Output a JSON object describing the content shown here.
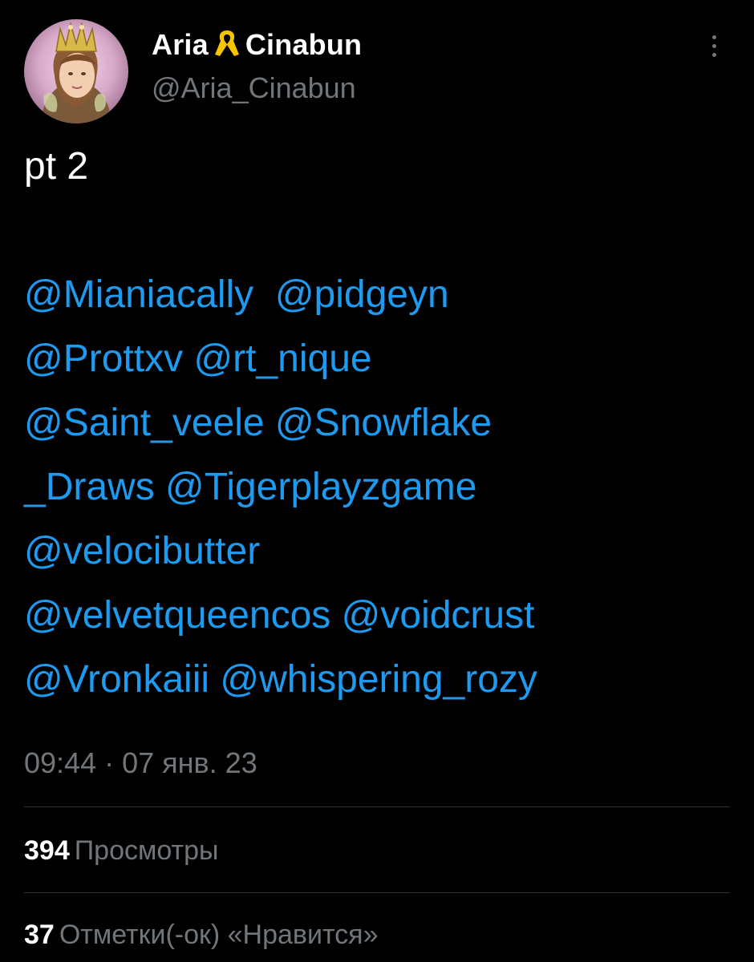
{
  "user": {
    "display_name_part1": "Aria",
    "display_name_part2": "Cinabun",
    "ribbon_icon": "yellow-ribbon-icon",
    "handle": "@Aria_Cinabun"
  },
  "tweet": {
    "intro": "pt 2",
    "lines": [
      [
        "@Mianiacally",
        "@pidgeyn"
      ],
      [
        "@Prottxv",
        "@rt_nique"
      ],
      [
        "@Saint_veele",
        "@Snowflake"
      ],
      [
        "_Draws",
        "@Tigerplayzgame"
      ],
      [
        "@velocibutter"
      ],
      [
        "@velvetqueencos",
        "@voidcrust"
      ],
      [
        "@Vronkaiii",
        "@whispering_rozy"
      ]
    ],
    "time": "09:44",
    "separator": "·",
    "date": "07 янв. 23"
  },
  "stats": {
    "views_count": "394",
    "views_label": "Просмотры",
    "likes_count": "37",
    "likes_label": "Отметки(-ок) «Нравится»"
  },
  "colors": {
    "background": "#000000",
    "mention": "#1d9bf0",
    "secondary_text": "#71767b",
    "divider": "#2f3336",
    "ribbon": "#f5c400"
  }
}
